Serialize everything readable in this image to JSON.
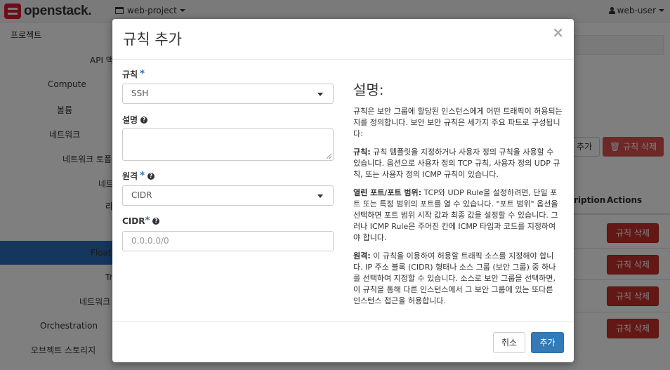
{
  "navbar": {
    "brand": "openstack.",
    "project": "web-project",
    "user": "web-user"
  },
  "sidebar": {
    "items": [
      {
        "label": "프로젝트"
      },
      {
        "label": "API 액"
      },
      {
        "label": "Compute"
      },
      {
        "label": "볼륨"
      },
      {
        "label": "네트워크"
      },
      {
        "label": "네트워크 토폴"
      },
      {
        "label": "네트"
      },
      {
        "label": "라"
      },
      {
        "label": "보안"
      },
      {
        "label": "Floati"
      },
      {
        "label": "Tr"
      },
      {
        "label": "네트워크"
      },
      {
        "label": "Orchestration"
      },
      {
        "label": "오브젝트 스토리지"
      }
    ]
  },
  "background": {
    "add_button": "추가",
    "delete_button": "규칙 삭제",
    "th_description": "ription",
    "th_actions": "Actions",
    "row_buttons": [
      "규칙 삭제",
      "규칙 삭제",
      "규칙 삭제",
      "규칙 삭제"
    ]
  },
  "modal": {
    "title": "규칙 추가",
    "close": "×",
    "rule_label": "규칙",
    "rule_value": "SSH",
    "description_label": "설명",
    "remote_label": "원격",
    "remote_value": "CIDR",
    "cidr_label": "CIDR",
    "cidr_placeholder": "0.0.0.0/0",
    "required_marker": "*",
    "help_marker": "?",
    "desc_title": "설명:",
    "desc_intro": "규칙은 보안 그룹에 할당된 인스턴스에게 어떤 트래픽이 허용되는지를 정의합니다. 보안 보안 규칙은 세가지 주요 파트로 구성됩니다:",
    "desc_rule_head": "규칙:",
    "desc_rule_body": " 규칙 템플릿을 지정하거나 사용자 정의 규칙을 사용할 수 있습니다. 옵션으로 사용자 정의 TCP 규칙, 사용자 정의 UDP 규칙, 또는 사용자 정의 ICMP 규칙이 있습니다.",
    "desc_port_head": "열린 포트/포트 범위:",
    "desc_port_body": " TCP와 UDP Rule을 설정하려면, 단일 포트 또는 특정 범위의 포트를 열 수 있습니다. \"포트 범위\" 옵션을 선택하면 포트 범위 시작 값과 최종 값을 설정할 수 있습니다. 그러나 ICMP Rule은 주어진 칸에 ICMP 타입과 코드를 지정하여야 합니다.",
    "desc_remote_head": "원격:",
    "desc_remote_body": " 이 규칙을 이용하여 허용할 트래픽 소스를 지정해야 합니다. IP 주소 블록 (CIDR) 형태나 소스 그룹 (보안 그룹) 중 하나를 선택하여 지정할 수 있습니다. 소스로 보안 그룹을 선택하면, 이 규칙을 통해 다른 인스턴스에서 그 보안 그룹에 있는 또다른 인스턴스 접근을 허용합니다.",
    "cancel_button": "취소",
    "submit_button": "추가"
  },
  "colors": {
    "accent": "#2a6ebb",
    "brand": "#da1a32",
    "danger": "#d9534f",
    "primary_button": "#337ab7"
  }
}
